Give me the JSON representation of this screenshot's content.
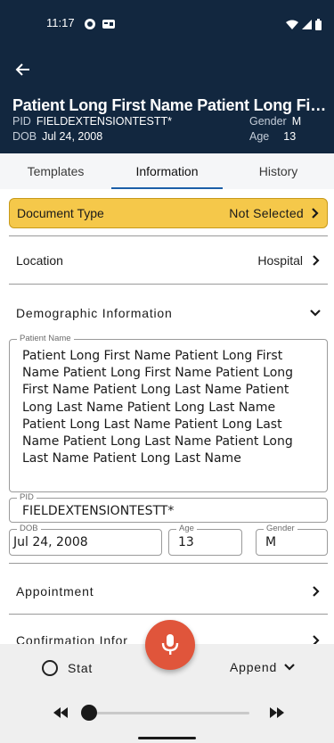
{
  "status_bar": {
    "time": "11:17"
  },
  "header": {
    "patient_name": "Patient Long First Name Patient Long First Name Patient Long First Name Patient Long Last Name Patient Long Last Name",
    "pid_label": "PID",
    "pid_value": "FIELDEXTENSIONTESTT*",
    "dob_label": "DOB",
    "dob_value": "Jul 24, 2008",
    "gender_label": "Gender",
    "gender_value": "M",
    "age_label": "Age",
    "age_value": "13"
  },
  "tabs": [
    {
      "label": "Templates"
    },
    {
      "label": "Information",
      "active": true
    },
    {
      "label": "History"
    }
  ],
  "document_type": {
    "label": "Document Type",
    "value": "Not Selected"
  },
  "location": {
    "label": "Location",
    "value": "Hospital"
  },
  "demographic": {
    "title": "Demographic Information",
    "patient_name_legend": "Patient Name",
    "patient_name_value": "Patient Long First Name Patient Long First Name Patient Long First Name Patient Long First Name Patient Long Last Name Patient Long Last Name Patient Long Last Name Patient Long Last Name Patient Long Last Name Patient Long Last Name Patient Long Last Name Patient Long Last Name",
    "pid_legend": "PID",
    "pid_value": "FIELDEXTENSIONTESTT*",
    "dob_legend": "DOB",
    "dob_value": "Jul 24, 2008",
    "age_legend": "Age",
    "age_value": "13",
    "gender_legend": "Gender",
    "gender_value": "M"
  },
  "appointment": {
    "label": "Appointment"
  },
  "confirmation": {
    "label": "Confirmation Infor"
  },
  "bottom": {
    "stat_label": "Stat",
    "append_label": "Append"
  },
  "colors": {
    "header_bg": "#12273f",
    "doc_type_bg": "#f5c84a",
    "tab_indicator": "#1c5fa8",
    "mic_button": "#e0553b"
  },
  "icons": [
    "back-arrow-icon",
    "chevron-right-icon",
    "chevron-down-icon",
    "microphone-icon",
    "rewind-icon",
    "fast-forward-icon",
    "wifi-icon",
    "signal-icon",
    "battery-icon"
  ]
}
